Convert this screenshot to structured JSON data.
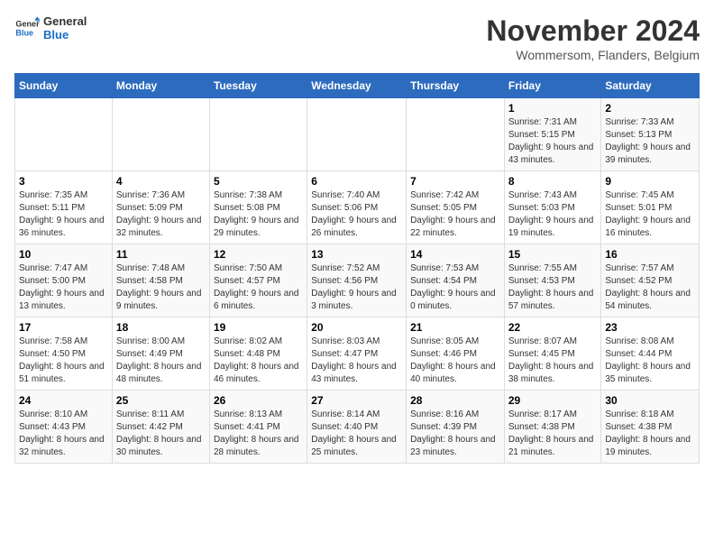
{
  "logo": {
    "line1": "General",
    "line2": "Blue"
  },
  "header": {
    "title": "November 2024",
    "subtitle": "Wommersom, Flanders, Belgium"
  },
  "weekdays": [
    "Sunday",
    "Monday",
    "Tuesday",
    "Wednesday",
    "Thursday",
    "Friday",
    "Saturday"
  ],
  "weeks": [
    [
      {
        "day": "",
        "info": ""
      },
      {
        "day": "",
        "info": ""
      },
      {
        "day": "",
        "info": ""
      },
      {
        "day": "",
        "info": ""
      },
      {
        "day": "",
        "info": ""
      },
      {
        "day": "1",
        "info": "Sunrise: 7:31 AM\nSunset: 5:15 PM\nDaylight: 9 hours and 43 minutes."
      },
      {
        "day": "2",
        "info": "Sunrise: 7:33 AM\nSunset: 5:13 PM\nDaylight: 9 hours and 39 minutes."
      }
    ],
    [
      {
        "day": "3",
        "info": "Sunrise: 7:35 AM\nSunset: 5:11 PM\nDaylight: 9 hours and 36 minutes."
      },
      {
        "day": "4",
        "info": "Sunrise: 7:36 AM\nSunset: 5:09 PM\nDaylight: 9 hours and 32 minutes."
      },
      {
        "day": "5",
        "info": "Sunrise: 7:38 AM\nSunset: 5:08 PM\nDaylight: 9 hours and 29 minutes."
      },
      {
        "day": "6",
        "info": "Sunrise: 7:40 AM\nSunset: 5:06 PM\nDaylight: 9 hours and 26 minutes."
      },
      {
        "day": "7",
        "info": "Sunrise: 7:42 AM\nSunset: 5:05 PM\nDaylight: 9 hours and 22 minutes."
      },
      {
        "day": "8",
        "info": "Sunrise: 7:43 AM\nSunset: 5:03 PM\nDaylight: 9 hours and 19 minutes."
      },
      {
        "day": "9",
        "info": "Sunrise: 7:45 AM\nSunset: 5:01 PM\nDaylight: 9 hours and 16 minutes."
      }
    ],
    [
      {
        "day": "10",
        "info": "Sunrise: 7:47 AM\nSunset: 5:00 PM\nDaylight: 9 hours and 13 minutes."
      },
      {
        "day": "11",
        "info": "Sunrise: 7:48 AM\nSunset: 4:58 PM\nDaylight: 9 hours and 9 minutes."
      },
      {
        "day": "12",
        "info": "Sunrise: 7:50 AM\nSunset: 4:57 PM\nDaylight: 9 hours and 6 minutes."
      },
      {
        "day": "13",
        "info": "Sunrise: 7:52 AM\nSunset: 4:56 PM\nDaylight: 9 hours and 3 minutes."
      },
      {
        "day": "14",
        "info": "Sunrise: 7:53 AM\nSunset: 4:54 PM\nDaylight: 9 hours and 0 minutes."
      },
      {
        "day": "15",
        "info": "Sunrise: 7:55 AM\nSunset: 4:53 PM\nDaylight: 8 hours and 57 minutes."
      },
      {
        "day": "16",
        "info": "Sunrise: 7:57 AM\nSunset: 4:52 PM\nDaylight: 8 hours and 54 minutes."
      }
    ],
    [
      {
        "day": "17",
        "info": "Sunrise: 7:58 AM\nSunset: 4:50 PM\nDaylight: 8 hours and 51 minutes."
      },
      {
        "day": "18",
        "info": "Sunrise: 8:00 AM\nSunset: 4:49 PM\nDaylight: 8 hours and 48 minutes."
      },
      {
        "day": "19",
        "info": "Sunrise: 8:02 AM\nSunset: 4:48 PM\nDaylight: 8 hours and 46 minutes."
      },
      {
        "day": "20",
        "info": "Sunrise: 8:03 AM\nSunset: 4:47 PM\nDaylight: 8 hours and 43 minutes."
      },
      {
        "day": "21",
        "info": "Sunrise: 8:05 AM\nSunset: 4:46 PM\nDaylight: 8 hours and 40 minutes."
      },
      {
        "day": "22",
        "info": "Sunrise: 8:07 AM\nSunset: 4:45 PM\nDaylight: 8 hours and 38 minutes."
      },
      {
        "day": "23",
        "info": "Sunrise: 8:08 AM\nSunset: 4:44 PM\nDaylight: 8 hours and 35 minutes."
      }
    ],
    [
      {
        "day": "24",
        "info": "Sunrise: 8:10 AM\nSunset: 4:43 PM\nDaylight: 8 hours and 32 minutes."
      },
      {
        "day": "25",
        "info": "Sunrise: 8:11 AM\nSunset: 4:42 PM\nDaylight: 8 hours and 30 minutes."
      },
      {
        "day": "26",
        "info": "Sunrise: 8:13 AM\nSunset: 4:41 PM\nDaylight: 8 hours and 28 minutes."
      },
      {
        "day": "27",
        "info": "Sunrise: 8:14 AM\nSunset: 4:40 PM\nDaylight: 8 hours and 25 minutes."
      },
      {
        "day": "28",
        "info": "Sunrise: 8:16 AM\nSunset: 4:39 PM\nDaylight: 8 hours and 23 minutes."
      },
      {
        "day": "29",
        "info": "Sunrise: 8:17 AM\nSunset: 4:38 PM\nDaylight: 8 hours and 21 minutes."
      },
      {
        "day": "30",
        "info": "Sunrise: 8:18 AM\nSunset: 4:38 PM\nDaylight: 8 hours and 19 minutes."
      }
    ]
  ]
}
